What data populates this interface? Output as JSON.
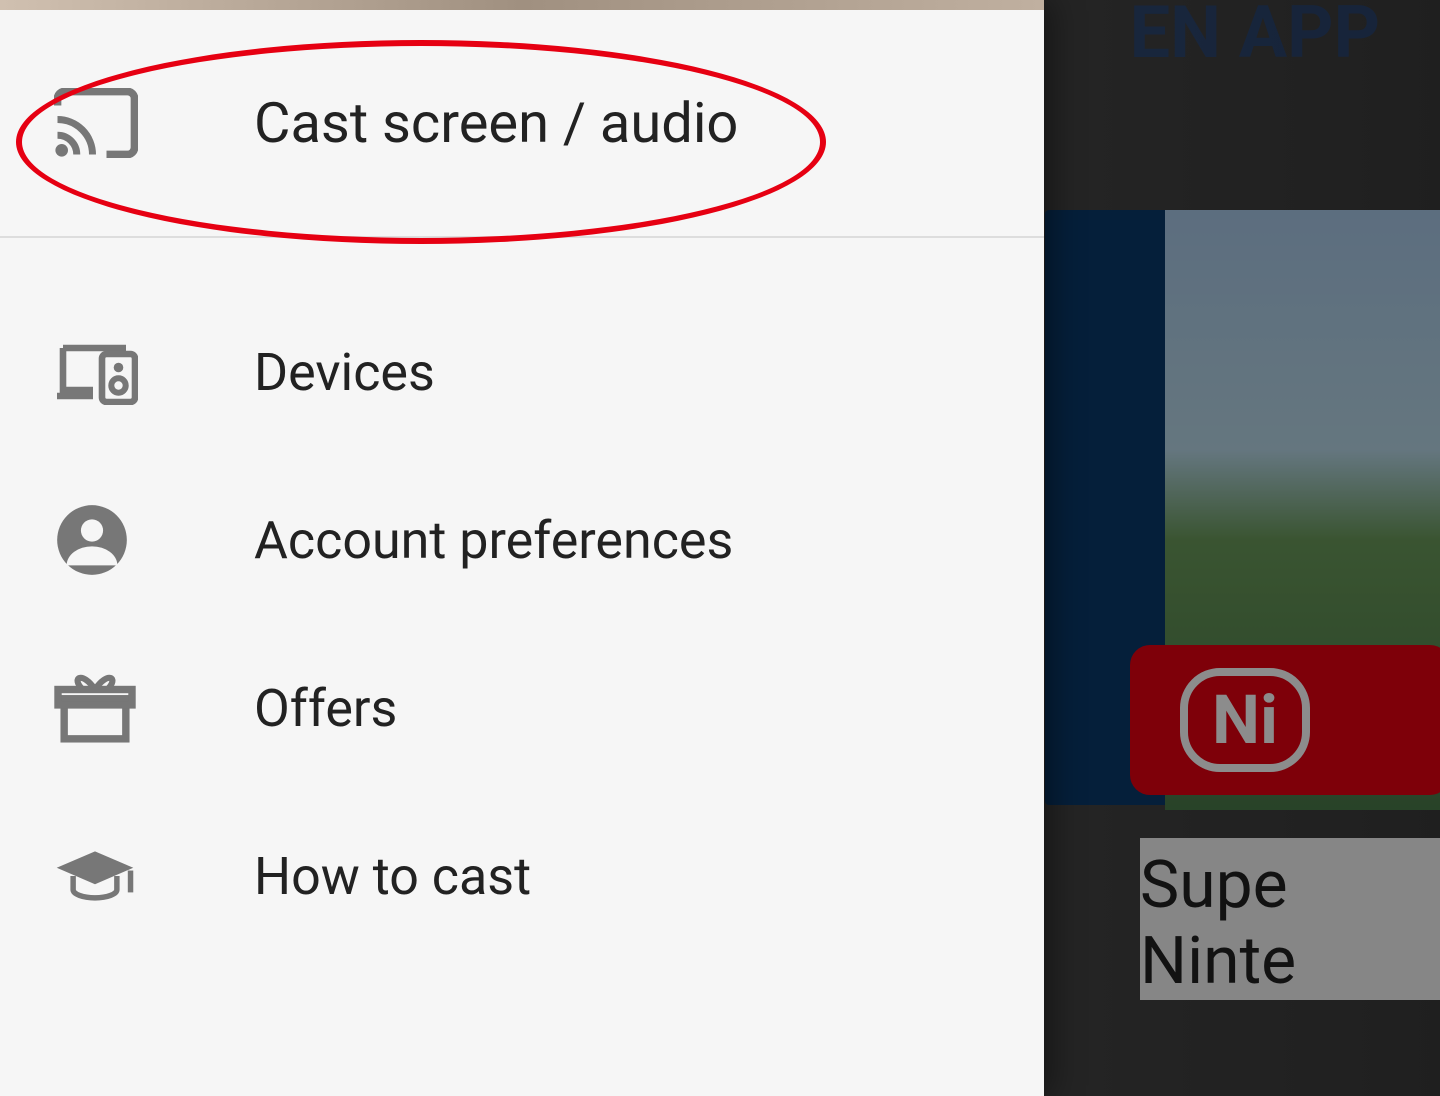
{
  "backdrop": {
    "app_label": "EN APP",
    "nintendo_partial": "Ni",
    "caption_line1": "Supe",
    "caption_line2": "Ninte"
  },
  "drawer": {
    "header": {
      "label": "Cast screen / audio"
    },
    "items": [
      {
        "id": "devices",
        "label": "Devices"
      },
      {
        "id": "account",
        "label": "Account preferences"
      },
      {
        "id": "offers",
        "label": "Offers"
      },
      {
        "id": "howto",
        "label": "How to cast"
      }
    ]
  },
  "annotation": {
    "circle_color": "#e60012"
  }
}
